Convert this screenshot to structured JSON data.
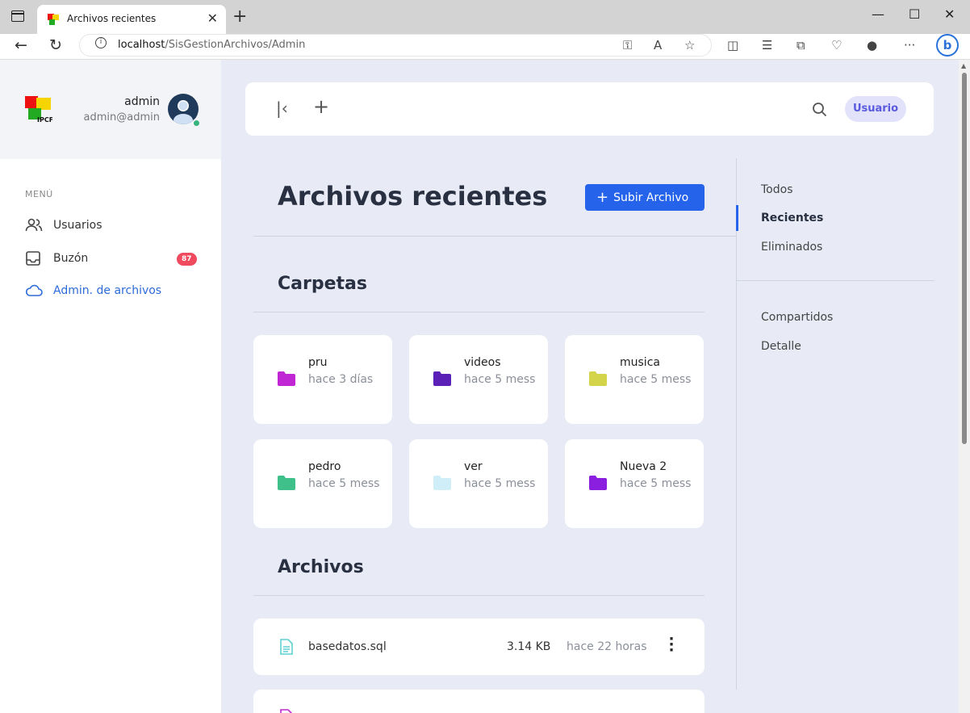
{
  "browser": {
    "tab_title": "Archivos recientes",
    "url_host": "localhost",
    "url_path": "/SisGestionArchivos/Admin"
  },
  "profile": {
    "name": "admin",
    "email": "admin@admin",
    "logo_text": "IPCF"
  },
  "menu": {
    "title": "MENÚ",
    "items": [
      {
        "label": "Usuarios",
        "icon": "users-icon"
      },
      {
        "label": "Buzón",
        "icon": "inbox-icon",
        "badge": "87"
      },
      {
        "label": "Admin. de archivos",
        "icon": "cloud-icon",
        "active": true
      }
    ]
  },
  "topbar": {
    "user_label": "Usuario"
  },
  "main": {
    "title": "Archivos recientes",
    "upload_label": "Subir Archivo",
    "folders_title": "Carpetas",
    "files_title": "Archivos",
    "folders": [
      {
        "name": "pru",
        "time": "hace 3 días",
        "color": "#c026d3"
      },
      {
        "name": "videos",
        "time": "hace 5 mess",
        "color": "#5b21b6"
      },
      {
        "name": "musica",
        "time": "hace 5 mess",
        "color": "#d4d44a"
      },
      {
        "name": "pedro",
        "time": "hace 5 mess",
        "color": "#3fbf8a"
      },
      {
        "name": "ver",
        "time": "hace 5 mess",
        "color": "#cfeef8"
      },
      {
        "name": "Nueva 2",
        "time": "hace 5 mess",
        "color": "#8b1fe0"
      }
    ],
    "files": [
      {
        "name": "basedatos.sql",
        "size": "3.14 KB",
        "time": "hace 22 horas",
        "color": "#5fd0d0"
      }
    ]
  },
  "rightnav": {
    "items": [
      "Todos",
      "Recientes",
      "Eliminados"
    ],
    "items2": [
      "Compartidos",
      "Detalle"
    ]
  },
  "colors": {
    "accent": "#2563eb",
    "badge": "#f04a5f",
    "online": "#36b37e"
  }
}
